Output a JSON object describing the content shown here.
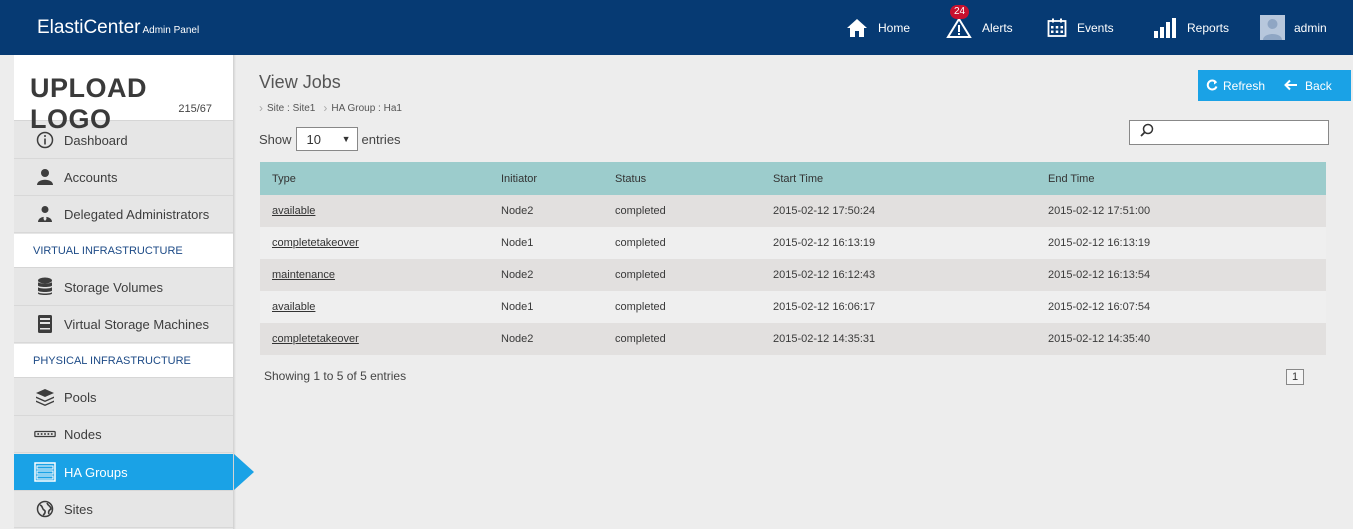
{
  "header": {
    "brand": "ElastiCenter",
    "brand_sub": "Admin Panel",
    "nav": [
      {
        "label": "Home",
        "icon": "home-icon"
      },
      {
        "label": "Alerts",
        "icon": "alert-icon",
        "badge": "24"
      },
      {
        "label": "Events",
        "icon": "calendar-icon"
      },
      {
        "label": "Reports",
        "icon": "bar-chart-icon"
      },
      {
        "label": "admin",
        "icon": "avatar"
      }
    ]
  },
  "sidebar": {
    "logo_text": "UPLOAD LOGO",
    "logo_size": "215/67",
    "items": [
      {
        "label": "Dashboard",
        "icon": "info-icon"
      },
      {
        "label": "Accounts",
        "icon": "user-icon"
      },
      {
        "label": "Delegated Administrators",
        "icon": "delegate-icon"
      },
      {
        "section": "VIRTUAL INFRASTRUCTURE"
      },
      {
        "label": "Storage Volumes",
        "icon": "database-icon"
      },
      {
        "label": "Virtual Storage Machines",
        "icon": "server-icon"
      },
      {
        "section": "PHYSICAL INFRASTRUCTURE"
      },
      {
        "label": "Pools",
        "icon": "layers-icon"
      },
      {
        "label": "Nodes",
        "icon": "node-icon"
      },
      {
        "label": "HA Groups",
        "icon": "ha-group-icon",
        "active": true
      },
      {
        "label": "Sites",
        "icon": "globe-icon"
      }
    ]
  },
  "main": {
    "title": "View Jobs",
    "breadcrumb": [
      "Site : Site1",
      "HA Group : Ha1"
    ],
    "buttons": {
      "refresh": "Refresh",
      "back": "Back"
    },
    "show_label": "Show",
    "entries_label": "entries",
    "page_size": "10",
    "search_placeholder": "",
    "table": {
      "columns": [
        "Type",
        "Initiator",
        "Status",
        "Start Time",
        "End Time"
      ],
      "rows": [
        [
          "available",
          "Node2",
          "completed",
          "2015-02-12 17:50:24",
          "2015-02-12 17:51:00"
        ],
        [
          "completetakeover",
          "Node1",
          "completed",
          "2015-02-12 16:13:19",
          "2015-02-12 16:13:19"
        ],
        [
          "maintenance",
          "Node2",
          "completed",
          "2015-02-12 16:12:43",
          "2015-02-12 16:13:54"
        ],
        [
          "available",
          "Node1",
          "completed",
          "2015-02-12 16:06:17",
          "2015-02-12 16:07:54"
        ],
        [
          "completetakeover",
          "Node2",
          "completed",
          "2015-02-12 14:35:31",
          "2015-02-12 14:35:40"
        ]
      ]
    },
    "info": "Showing 1 to 5 of 5 entries",
    "page": "1"
  },
  "colors": {
    "header_bg": "#063a73",
    "accent": "#1aa2e6",
    "table_header": "#9ccccc",
    "badge": "#c8102e"
  }
}
